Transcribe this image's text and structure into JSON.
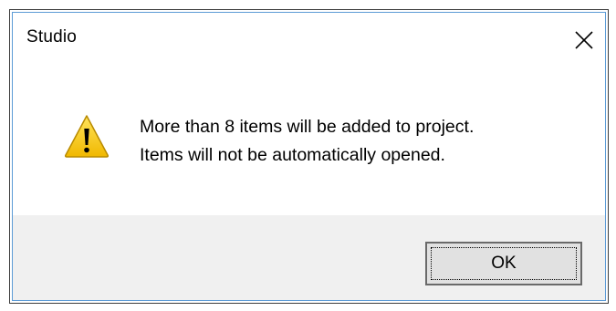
{
  "dialog": {
    "title": "Studio",
    "close_icon": "close-icon",
    "warning_icon": "warning-icon",
    "message_lines": [
      "More than 8 items will be added to project.",
      "Items will not be automatically opened."
    ],
    "ok_label": "OK"
  },
  "colors": {
    "accent_border": "#5c9bd6",
    "footer_background": "#f0f0f0",
    "warning_yellow": "#f5c400"
  }
}
